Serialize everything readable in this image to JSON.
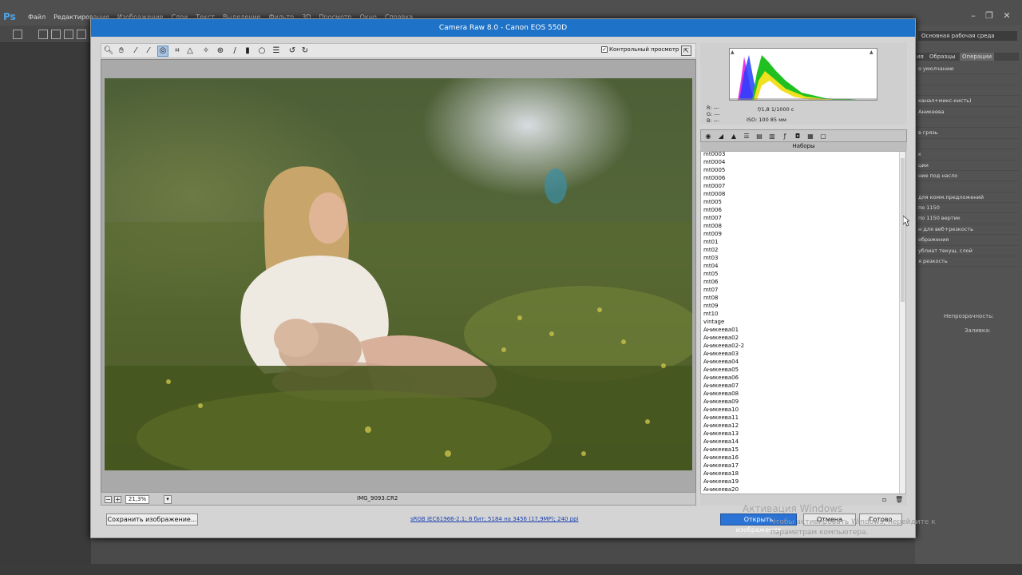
{
  "ps": {
    "logo": "Ps",
    "menu": [
      "Файл",
      "Редактирование",
      "Изображение",
      "Слои",
      "Текст",
      "Выделение",
      "Фильтр",
      "3D",
      "Просмотр",
      "Окно",
      "Справка"
    ],
    "workspace": "Основная рабочая среда",
    "panel_tabs": [
      "ия",
      "Образцы",
      "Операции"
    ],
    "actions": [
      "о умолчанию",
      "",
      "",
      "канал+микс-кисть)",
      "Аникеева",
      "",
      "в грязь",
      "",
      "к",
      "ции",
      "ние под насло",
      "",
      "для комм.предложений",
      "по 1150",
      "по 1150 вертик",
      "н для веб+резкость",
      "ображения",
      "ублиат текущ. слой",
      "я резкость"
    ],
    "opacity_label": "Непрозрачность:",
    "fill_label": "Заливка:"
  },
  "dialog": {
    "title": "Camera Raw 8.0  -  Canon EOS 550D",
    "preview_label": "Контрольный просмотр",
    "preview_checked": "✓",
    "zoom": "21,3%",
    "filename": "IMG_9093.CR2",
    "rgb": {
      "r": "R:  ---",
      "g": "G:  ---",
      "b": "B:  ---"
    },
    "camera": {
      "aperture_shutter": "f/1,8   1/1000 с",
      "iso_focal": "ISO: 100   85 мм"
    },
    "presets_title": "Наборы",
    "presets": [
      "mt0003",
      "mt0004",
      "mt0005",
      "mt0006",
      "mt0007",
      "mt0008",
      "mt005",
      "mt006",
      "mt007",
      "mt008",
      "mt009",
      "mt01",
      "mt02",
      "mt03",
      "mt04",
      "mt05",
      "mt06",
      "mt07",
      "mt08",
      "mt09",
      "mt10",
      "vintage",
      "Аникеева01",
      "Аникеева02",
      "Аникеева02-2",
      "Аникеева03",
      "Аникеева04",
      "Аникеева05",
      "Аникеева06",
      "Аникеева07",
      "Аникеева08",
      "Аникеева09",
      "Аникеева10",
      "Аникеева11",
      "Аникеева12",
      "Аникеева13",
      "Аникеева14",
      "Аникеева15",
      "Аникеева16",
      "Аникеева17",
      "Аникеева18",
      "Аникеева19",
      "Аникеева20"
    ],
    "save_button": "Сохранить изображение...",
    "workflow": "sRGB IEC61966-2.1; 8 бит; 5184 на 3456 (17,9МР); 240 ppi",
    "open_button": "Открыть изображение",
    "cancel_button": "Отмена",
    "done_button": "Готово"
  },
  "watermark": {
    "title": "Активация Windows",
    "text": "Чтобы активировать Windows, перейдите к параметрам компьютера."
  }
}
